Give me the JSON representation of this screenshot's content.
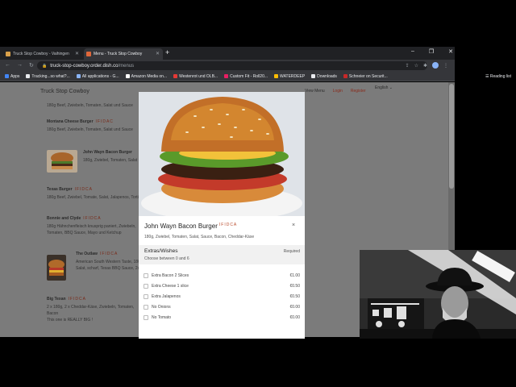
{
  "browser": {
    "tabs": [
      {
        "label": "Truck Stop Cowboy - Vaihingen"
      },
      {
        "label": "Menu - Truck Stop Cowboy"
      }
    ],
    "url_host": "truck-stop-cowboy.order.dish.co",
    "url_path": "/menus",
    "bookmarks": [
      "Apps",
      "Tracking...so what?...",
      "All applications - G...",
      "Amazon Media on...",
      "Westenrot und OLB...",
      "Custom Fit - Roll20...",
      "WATERDEEP",
      "Downloads",
      "Schneier on Securit..."
    ],
    "reading_list": "Reading list"
  },
  "page": {
    "restaurant": "Truck Stop Cowboy",
    "nav": {
      "view_menu": "View Menu",
      "login": "Login",
      "register": "Register"
    },
    "language": "English",
    "items": [
      {
        "name": "",
        "tags": "",
        "desc": "180g Beef, Zwiebeln, Tomaten, Salat und Sauce"
      },
      {
        "name": "Montana Cheese Burger",
        "tags": "IFIDAC",
        "desc": "180g Beef, Zwiebeln, Tomaten, Salat und Sauce"
      },
      {
        "name": "John Wayn Bacon Burger",
        "tags": "",
        "desc": "180g, Zwiebel, Tomaten, Salat"
      },
      {
        "name": "Texas Burger",
        "tags": "IFIDCA",
        "desc": "180g Beef, Zwiebel, Tomate, Salat, Jalapenos, Tortilla"
      },
      {
        "name": "Bonnie and Clyde",
        "tags": "IFIDCA",
        "desc": "180g Hähnchenfleisch knusprig paniert, Zwiebeln, Tomaten, BBQ Sauce, Mayo und Ketchup"
      },
      {
        "name": "The Outlaw",
        "tags": "IFIDCA",
        "desc": "American South Western Taste, 180g Beef, Tomaten, Salat, scharf, Texas BBQ Sauce, 2xCheddar"
      },
      {
        "name": "Big Texan",
        "tags": "IFIDCA",
        "desc": "2 x 180g, 2 x Cheddar-Käse, Zwiebeln, Tomaten, Bacon\nThis one is REALLY BIG !"
      }
    ]
  },
  "modal": {
    "title": "John Wayn Bacon Burger",
    "tags": "IFIDCA",
    "description": "180g, Zwiebel, Tomaten, Salat, Sauce, Bacon, Cheddar-Käse",
    "close": "×",
    "extras_title": "Extras/Wishes",
    "extras_sub": "Choose between 0 and 6",
    "extras_required": "Required",
    "options": [
      {
        "label": "Extra Bacon 2 Slices",
        "price": "€1.00"
      },
      {
        "label": "Extra Cheese 1 slice",
        "price": "€0.50"
      },
      {
        "label": "Extra Jalapenos",
        "price": "€0.50"
      },
      {
        "label": "No Onions",
        "price": "€0.00"
      },
      {
        "label": "No Tomato",
        "price": "€0.00"
      }
    ]
  },
  "colors": {
    "accent": "#b94a2a",
    "overlay": "#7b7b7b",
    "chrome_dark": "#202124"
  }
}
